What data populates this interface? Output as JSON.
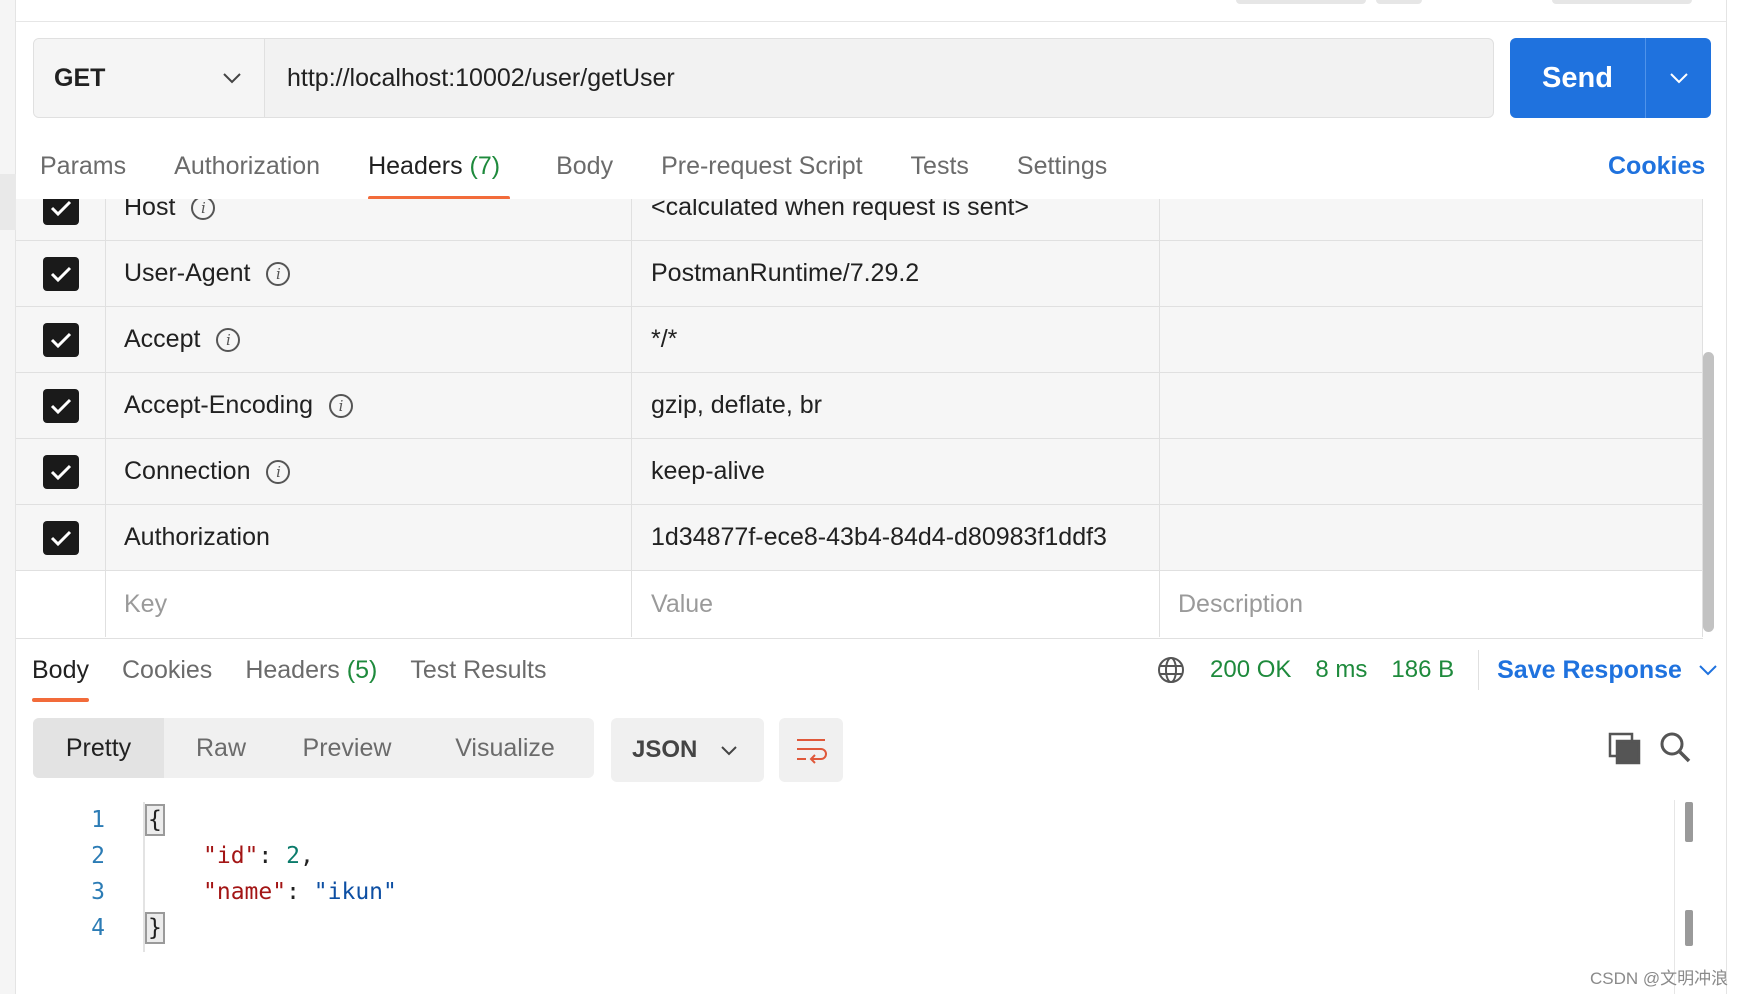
{
  "request": {
    "method": "GET",
    "url": "http://localhost:10002/user/getUser",
    "send_label": "Send"
  },
  "request_tabs": [
    {
      "label": "Params",
      "count": ""
    },
    {
      "label": "Authorization",
      "count": ""
    },
    {
      "label": "Headers",
      "count": "(7)"
    },
    {
      "label": "Body",
      "count": ""
    },
    {
      "label": "Pre-request Script",
      "count": ""
    },
    {
      "label": "Tests",
      "count": ""
    },
    {
      "label": "Settings",
      "count": ""
    }
  ],
  "active_request_tab": "Headers",
  "cookies_label": "Cookies",
  "headers": [
    {
      "key": "Host",
      "value": "<calculated when request is sent>",
      "checked": true,
      "info": true
    },
    {
      "key": "User-Agent",
      "value": "PostmanRuntime/7.29.2",
      "checked": true,
      "info": true
    },
    {
      "key": "Accept",
      "value": "*/*",
      "checked": true,
      "info": true
    },
    {
      "key": "Accept-Encoding",
      "value": "gzip, deflate, br",
      "checked": true,
      "info": true
    },
    {
      "key": "Connection",
      "value": "keep-alive",
      "checked": true,
      "info": true
    },
    {
      "key": "Authorization",
      "value": "1d34877f-ece8-43b4-84d4-d80983f1ddf3",
      "checked": true,
      "info": false
    }
  ],
  "header_placeholders": {
    "key": "Key",
    "value": "Value",
    "description": "Description"
  },
  "response_tabs": [
    {
      "label": "Body",
      "count": ""
    },
    {
      "label": "Cookies",
      "count": ""
    },
    {
      "label": "Headers",
      "count": "(5)"
    },
    {
      "label": "Test Results",
      "count": ""
    }
  ],
  "active_response_tab": "Body",
  "response_status": {
    "status": "200 OK",
    "time": "8 ms",
    "size": "186 B"
  },
  "save_response_label": "Save Response",
  "view_modes": [
    "Pretty",
    "Raw",
    "Preview",
    "Visualize"
  ],
  "active_view_mode": "Pretty",
  "format": "JSON",
  "code_lines": [
    {
      "num": "1",
      "text": "{"
    },
    {
      "num": "2",
      "key": "\"id\"",
      "sep": ": ",
      "value": "2",
      "trail": ","
    },
    {
      "num": "3",
      "key": "\"name\"",
      "sep": ": ",
      "value": "\"ikun\"",
      "trail": ""
    },
    {
      "num": "4",
      "text": "}"
    }
  ],
  "watermark": "CSDN @文明冲浪",
  "colors": {
    "accent": "#1f72de",
    "tab_underline": "#f26b3a",
    "status_green": "#1e8a3c"
  }
}
